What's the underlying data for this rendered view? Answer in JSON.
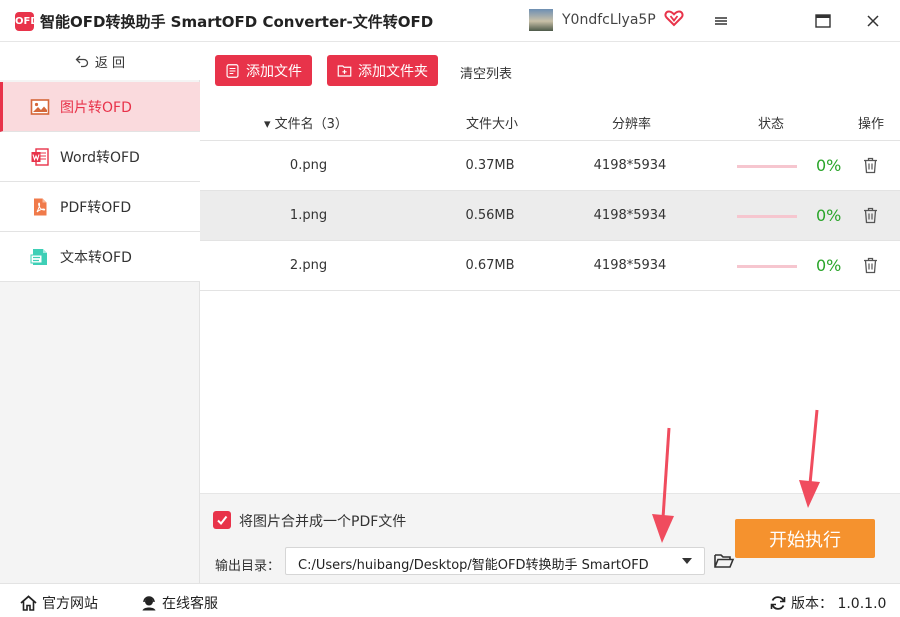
{
  "window": {
    "title": "智能OFD转换助手 SmartOFD Converter-文件转OFD",
    "logo_text": "OFD",
    "user_name": "Y0ndfcLlya5P",
    "icons": [
      "minimize-icon",
      "maximize-icon",
      "close-icon",
      "vip-heart-icon"
    ]
  },
  "sidebar": {
    "back_label": "返 回",
    "items": [
      {
        "label": "图片转OFD",
        "icon": "image-icon",
        "active": true
      },
      {
        "label": "Word转OFD",
        "icon": "word-icon",
        "active": false
      },
      {
        "label": "PDF转OFD",
        "icon": "pdf-icon",
        "active": false
      },
      {
        "label": "文本转OFD",
        "icon": "text-file-icon",
        "active": false
      }
    ]
  },
  "toolbar": {
    "add_file": "添加文件",
    "add_folder": "添加文件夹",
    "clear_list": "清空列表"
  },
  "table": {
    "headers": {
      "name": "▾ 文件名（3）",
      "size": "文件大小",
      "resolution": "分辨率",
      "status": "状态",
      "action": "操作"
    },
    "rows": [
      {
        "name": "0.png",
        "size": "0.37MB",
        "resolution": "4198*5934",
        "progress": 0,
        "status": "0%"
      },
      {
        "name": "1.png",
        "size": "0.56MB",
        "resolution": "4198*5934",
        "progress": 0,
        "status": "0%"
      },
      {
        "name": "2.png",
        "size": "0.67MB",
        "resolution": "4198*5934",
        "progress": 0,
        "status": "0%"
      }
    ]
  },
  "options": {
    "merge_label": "将图片合并成一个PDF文件",
    "merge_checked": true,
    "output_label": "输出目录：",
    "output_path": "C:/Users/huibang/Desktop/智能OFD转换助手 SmartOFD",
    "start_label": "开始执行"
  },
  "footer": {
    "website": "官方网站",
    "service": "在线客服",
    "version": "版本： 1.0.1.0"
  },
  "colors": {
    "accent": "#e8334a",
    "start_button": "#f5922e",
    "status_green": "#2aa52a",
    "annotation_arrow": "#f04c5e"
  }
}
